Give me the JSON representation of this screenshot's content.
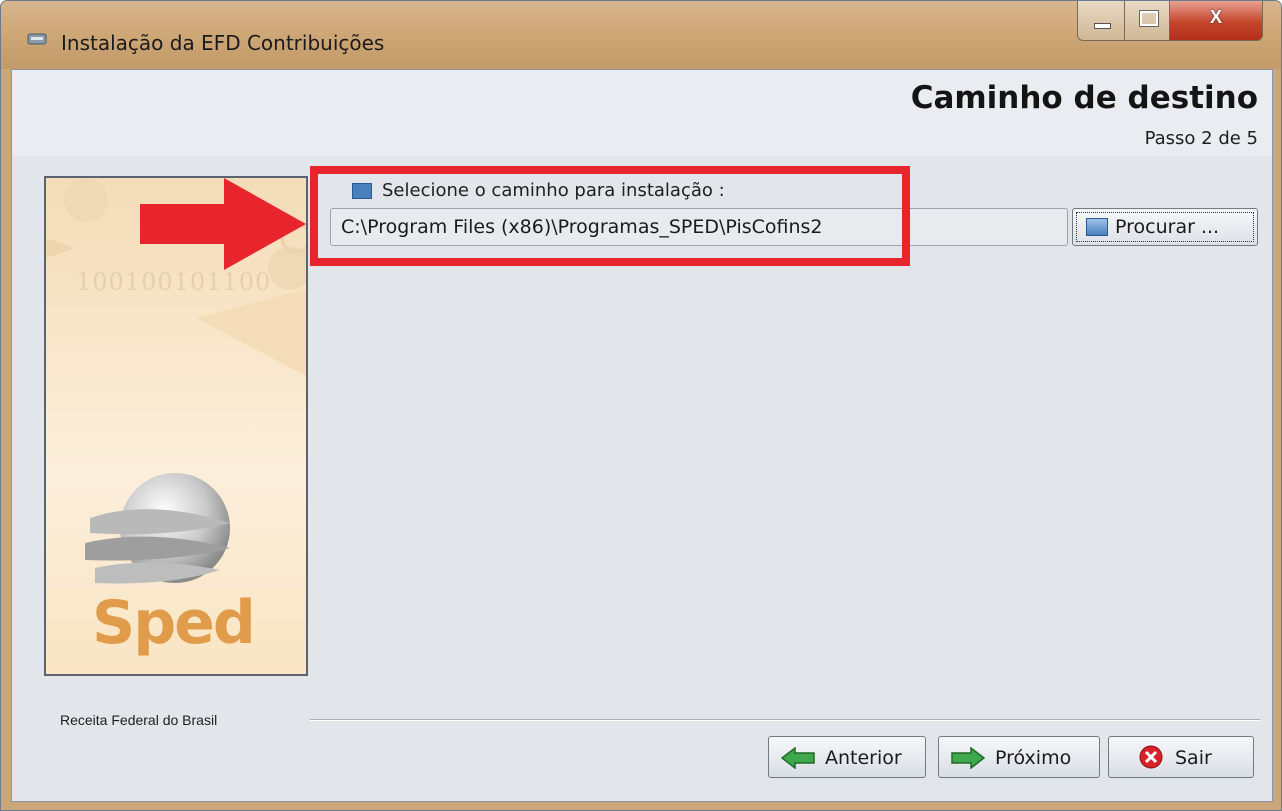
{
  "window": {
    "title": "Instalação da EFD Contribuições",
    "close_glyph": "X"
  },
  "header": {
    "title": "Caminho de destino",
    "step": "Passo 2 de 5"
  },
  "sidebar": {
    "binary_text": "100100101100",
    "logo_text": "Sped"
  },
  "path": {
    "label": "Selecione o caminho para instalação :",
    "value": "C:\\Program Files (x86)\\Programas_SPED\\PisCofins2",
    "browse_label": "Procurar ..."
  },
  "footer": {
    "org": "Receita Federal do Brasil",
    "prev_label": "Anterior",
    "next_label": "Próximo",
    "exit_label": "Sair"
  },
  "colors": {
    "annotation": "#e8252c",
    "sped_orange": "#e09c4a",
    "arrow_green": "#3ea84a"
  }
}
